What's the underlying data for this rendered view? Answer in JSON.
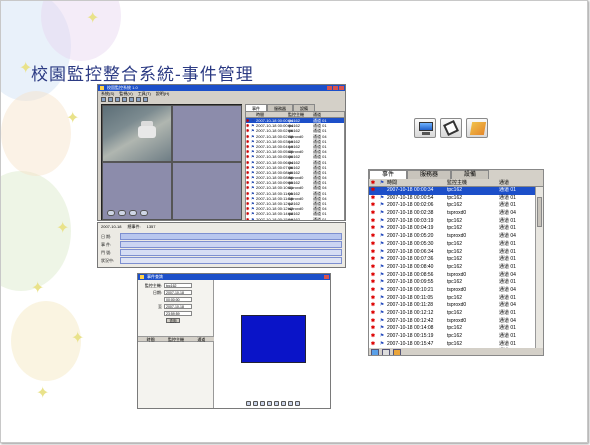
{
  "slide": {
    "title": "校園監控整合系統-事件管理"
  },
  "main_window": {
    "title": "校園監控系統 1.0",
    "menu": [
      "系統(S)",
      "監視(V)",
      "工具(T)",
      "說明(H)"
    ],
    "tabs": [
      "事件",
      "服務器",
      "設備"
    ],
    "columns": [
      "時間",
      "監控主機",
      "通道"
    ],
    "rows": [
      [
        "2007-10-18 00:00:34",
        "tpc162",
        "通道 01"
      ],
      [
        "2007-10-18 00:00:54",
        "tpc162",
        "通道 01"
      ],
      [
        "2007-10-18 00:02:06",
        "tpc162",
        "通道 01"
      ],
      [
        "2007-10-18 00:02:38",
        "tsproxd0",
        "通道 04"
      ],
      [
        "2007-10-18 00:03:19",
        "tpc162",
        "通道 01"
      ],
      [
        "2007-10-18 00:04:19",
        "tpc162",
        "通道 01"
      ],
      [
        "2007-10-18 00:05:20",
        "tsproxd0",
        "通道 04"
      ],
      [
        "2007-10-18 00:05:30",
        "tpc162",
        "通道 01"
      ],
      [
        "2007-10-18 00:06:34",
        "tpc162",
        "通道 01"
      ],
      [
        "2007-10-18 00:07:36",
        "tpc162",
        "通道 01"
      ],
      [
        "2007-10-18 00:08:40",
        "tpc162",
        "通道 01"
      ],
      [
        "2007-10-18 00:08:56",
        "tsproxd0",
        "通道 04"
      ],
      [
        "2007-10-18 00:09:55",
        "tpc162",
        "通道 01"
      ],
      [
        "2007-10-18 00:10:21",
        "tsproxd0",
        "通道 04"
      ],
      [
        "2007-10-18 00:11:05",
        "tpc162",
        "通道 01"
      ],
      [
        "2007-10-18 00:11:28",
        "tsproxd0",
        "通道 04"
      ],
      [
        "2007-10-18 00:12:12",
        "tpc162",
        "通道 01"
      ],
      [
        "2007-10-18 00:12:42",
        "tsproxd0",
        "通道 04"
      ],
      [
        "2007-10-18 00:14:08",
        "tpc162",
        "通道 01"
      ],
      [
        "2007-10-18 00:15:19",
        "tpc162",
        "通道 01"
      ]
    ],
    "timeline_labels": [
      "日 期:",
      "事 件:",
      "門 號:",
      "狀況中:"
    ],
    "timeline_values": [
      "2007-10-18",
      "總事件:",
      "1357"
    ]
  },
  "event_panel": {
    "tabs": [
      "事件",
      "服務器",
      "設備"
    ],
    "columns": [
      "時間",
      "監控主機",
      "通道"
    ],
    "selected_index": 0,
    "rows": [
      [
        "2007-10-18 00:00:34",
        "tpc162",
        "通道 01"
      ],
      [
        "2007-10-18 00:00:54",
        "tpc162",
        "通道 01"
      ],
      [
        "2007-10-18 00:02:06",
        "tpc162",
        "通道 01"
      ],
      [
        "2007-10-18 00:02:38",
        "tsproxd0",
        "通道 04"
      ],
      [
        "2007-10-18 00:03:19",
        "tpc162",
        "通道 01"
      ],
      [
        "2007-10-18 00:04:19",
        "tpc162",
        "通道 01"
      ],
      [
        "2007-10-18 00:05:20",
        "tsproxd0",
        "通道 04"
      ],
      [
        "2007-10-18 00:05:30",
        "tpc162",
        "通道 01"
      ],
      [
        "2007-10-18 00:06:34",
        "tpc162",
        "通道 01"
      ],
      [
        "2007-10-18 00:07:36",
        "tpc162",
        "通道 01"
      ],
      [
        "2007-10-18 00:08:40",
        "tpc162",
        "通道 01"
      ],
      [
        "2007-10-18 00:08:56",
        "tsproxd0",
        "通道 04"
      ],
      [
        "2007-10-18 00:09:55",
        "tpc162",
        "通道 01"
      ],
      [
        "2007-10-18 00:10:21",
        "tsproxd0",
        "通道 04"
      ],
      [
        "2007-10-18 00:11:05",
        "tpc162",
        "通道 01"
      ],
      [
        "2007-10-18 00:11:28",
        "tsproxd0",
        "通道 04"
      ],
      [
        "2007-10-18 00:12:12",
        "tpc162",
        "通道 01"
      ],
      [
        "2007-10-18 00:12:42",
        "tsproxd0",
        "通道 04"
      ],
      [
        "2007-10-18 00:14:08",
        "tpc162",
        "通道 01"
      ],
      [
        "2007-10-18 00:15:19",
        "tpc162",
        "通道 01"
      ],
      [
        "2007-10-18 00:15:47",
        "tpc162",
        "通道 01"
      ],
      [
        "2007-10-18 00:16:19",
        "tpc162",
        "通道 01"
      ],
      [
        "2007-10-18 00:17:34",
        "tpc162",
        "通道 01"
      ]
    ]
  },
  "search_window": {
    "title": "事件查詢",
    "fields": [
      {
        "label": "監控主機:",
        "value": "tpc162"
      },
      {
        "label": "日期:",
        "value": "2007-10-18"
      },
      {
        "label": "",
        "value": "00:00:00"
      },
      {
        "label": "至",
        "value": "2007-10-18"
      },
      {
        "label": "",
        "value": "23:59:59"
      }
    ],
    "search_button": "查詢",
    "list_columns": [
      "時間",
      "監控主機",
      "通道"
    ]
  },
  "icons": [
    "monitor-icon",
    "camera-icon",
    "folder-icon"
  ],
  "colors": {
    "title_text": "#2b3a83",
    "title_bar": "#1c4fc9",
    "selection": "#1c4fc9",
    "video_preview": "#0a14c8"
  }
}
